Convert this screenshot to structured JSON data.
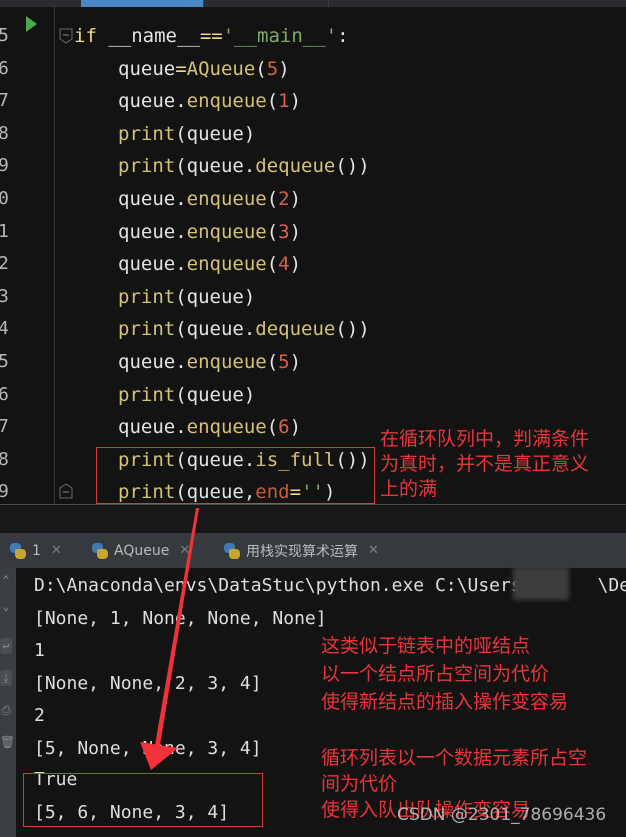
{
  "editor": {
    "lines": [
      {
        "num": "5",
        "tokens": [
          [
            "kw",
            "if "
          ],
          [
            "par",
            "__name__"
          ],
          [
            "kw",
            "=="
          ],
          [
            "str",
            "'__main__'"
          ],
          [
            "par",
            ":"
          ]
        ]
      },
      {
        "num": "6",
        "tokens": [
          [
            "par",
            "queue"
          ],
          [
            "kw",
            "="
          ],
          [
            "fn",
            "AQueue"
          ],
          [
            "par",
            "("
          ],
          [
            "num",
            "5"
          ],
          [
            "par",
            ")"
          ]
        ]
      },
      {
        "num": "7",
        "tokens": [
          [
            "par",
            "queue."
          ],
          [
            "fn",
            "enqueue"
          ],
          [
            "par",
            "("
          ],
          [
            "num",
            "1"
          ],
          [
            "par",
            ")"
          ]
        ]
      },
      {
        "num": "8",
        "tokens": [
          [
            "bi",
            "print"
          ],
          [
            "par",
            "(queue)"
          ]
        ]
      },
      {
        "num": "9",
        "tokens": [
          [
            "bi",
            "print"
          ],
          [
            "par",
            "(queue."
          ],
          [
            "fn",
            "dequeue"
          ],
          [
            "par",
            "())"
          ]
        ]
      },
      {
        "num": "0",
        "tokens": [
          [
            "par",
            "queue."
          ],
          [
            "fn",
            "enqueue"
          ],
          [
            "par",
            "("
          ],
          [
            "num",
            "2"
          ],
          [
            "par",
            ")"
          ]
        ]
      },
      {
        "num": "1",
        "tokens": [
          [
            "par",
            "queue."
          ],
          [
            "fn",
            "enqueue"
          ],
          [
            "par",
            "("
          ],
          [
            "num",
            "3"
          ],
          [
            "par",
            ")"
          ]
        ]
      },
      {
        "num": "2",
        "tokens": [
          [
            "par",
            "queue."
          ],
          [
            "fn",
            "enqueue"
          ],
          [
            "par",
            "("
          ],
          [
            "num",
            "4"
          ],
          [
            "par",
            ")"
          ]
        ]
      },
      {
        "num": "3",
        "tokens": [
          [
            "bi",
            "print"
          ],
          [
            "par",
            "(queue)"
          ]
        ]
      },
      {
        "num": "4",
        "tokens": [
          [
            "bi",
            "print"
          ],
          [
            "par",
            "(queue."
          ],
          [
            "fn",
            "dequeue"
          ],
          [
            "par",
            "())"
          ]
        ]
      },
      {
        "num": "5",
        "tokens": [
          [
            "par",
            "queue."
          ],
          [
            "fn",
            "enqueue"
          ],
          [
            "par",
            "("
          ],
          [
            "num",
            "5"
          ],
          [
            "par",
            ")"
          ]
        ]
      },
      {
        "num": "6",
        "tokens": [
          [
            "bi",
            "print"
          ],
          [
            "par",
            "(queue)"
          ]
        ]
      },
      {
        "num": "7",
        "tokens": [
          [
            "par",
            "queue."
          ],
          [
            "fn",
            "enqueue"
          ],
          [
            "par",
            "("
          ],
          [
            "num",
            "6"
          ],
          [
            "par",
            ")"
          ]
        ]
      },
      {
        "num": "8",
        "tokens": [
          [
            "bi",
            "print"
          ],
          [
            "par",
            "(queue."
          ],
          [
            "fn",
            "is_full"
          ],
          [
            "par",
            "())"
          ]
        ]
      },
      {
        "num": "9",
        "tokens": [
          [
            "bi",
            "print"
          ],
          [
            "par",
            "(queue,"
          ],
          [
            "param",
            "end"
          ],
          [
            "kw",
            "="
          ],
          [
            "str",
            "''"
          ],
          [
            "par",
            ")"
          ]
        ]
      }
    ]
  },
  "annotations": {
    "full_condition": [
      "在循环队列中，判满条件",
      "为真时，并不是真正意义",
      "上的满"
    ],
    "dummy_node": [
      "这类似于链表中的哑结点",
      "以一个结点所占空间为代价",
      "使得新结点的插入操作变容易"
    ],
    "circular_list": [
      "循环列表以一个数据元素所占空",
      "间为代价",
      "使得入队出队操作变容易"
    ]
  },
  "run_tabs": [
    {
      "label": "1",
      "active": false
    },
    {
      "label": "AQueue",
      "active": true
    },
    {
      "label": "用栈实现算术运算",
      "active": false
    }
  ],
  "console": {
    "command": "D:\\Anaconda\\envs\\DataStuc\\python.exe C:\\Users\\      \\Desk",
    "output": [
      "[None, 1, None, None, None]",
      "1",
      "[None, None, 2, 3, 4]",
      "2",
      "[5, None, None, 3, 4]",
      "True",
      "[5, 6, None, 3, 4]"
    ]
  },
  "watermark": "CSDN @2301_78696436",
  "colors": {
    "annotation_red": "#e8353a",
    "run_green": "#4bab49",
    "active_tab_blue": "#4a88c7"
  }
}
